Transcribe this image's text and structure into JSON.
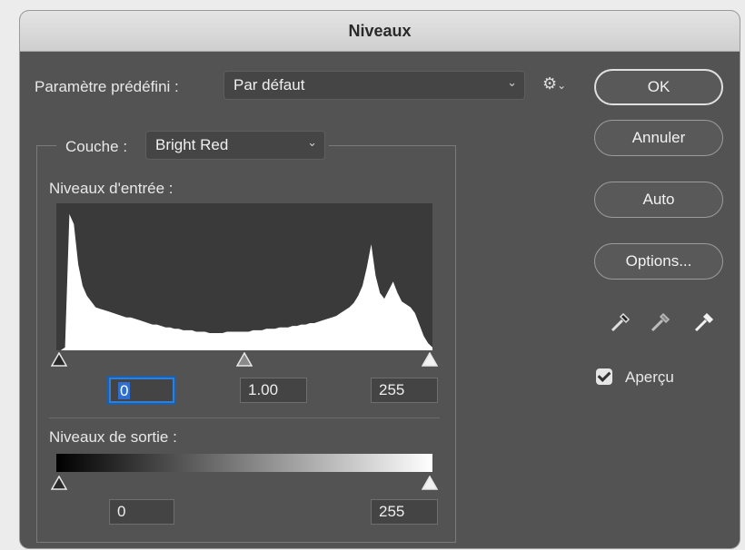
{
  "dialog": {
    "title": "Niveaux"
  },
  "preset": {
    "label": "Paramètre prédéfini :",
    "value": "Par défaut"
  },
  "channel": {
    "label": "Couche :",
    "value": "Bright Red"
  },
  "input_levels": {
    "label": "Niveaux d'entrée :",
    "black": "0",
    "gamma": "1.00",
    "white": "255"
  },
  "output_levels": {
    "label": "Niveaux de sortie :",
    "black": "0",
    "white": "255"
  },
  "buttons": {
    "ok": "OK",
    "cancel": "Annuler",
    "auto": "Auto",
    "options": "Options..."
  },
  "preview": {
    "label": "Aperçu",
    "checked": true
  },
  "icons": {
    "settings": "gear-icon",
    "black_eyedropper": "eyedropper-black-icon",
    "gray_eyedropper": "eyedropper-gray-icon",
    "white_eyedropper": "eyedropper-white-icon"
  },
  "histogram_levels": [
    0,
    0,
    2,
    95,
    88,
    60,
    45,
    38,
    34,
    30,
    29,
    28,
    27,
    26,
    25,
    24,
    23,
    23,
    22,
    21,
    20,
    19,
    18,
    18,
    17,
    16,
    16,
    15,
    15,
    14,
    14,
    14,
    13,
    13,
    13,
    12,
    12,
    12,
    12,
    13,
    13,
    13,
    13,
    13,
    13,
    14,
    14,
    14,
    15,
    15,
    15,
    16,
    16,
    16,
    17,
    17,
    18,
    18,
    19,
    19,
    20,
    21,
    22,
    23,
    24,
    26,
    28,
    30,
    33,
    38,
    45,
    58,
    74,
    52,
    40,
    36,
    42,
    48,
    40,
    34,
    32,
    30,
    26,
    18,
    10,
    5,
    2
  ]
}
